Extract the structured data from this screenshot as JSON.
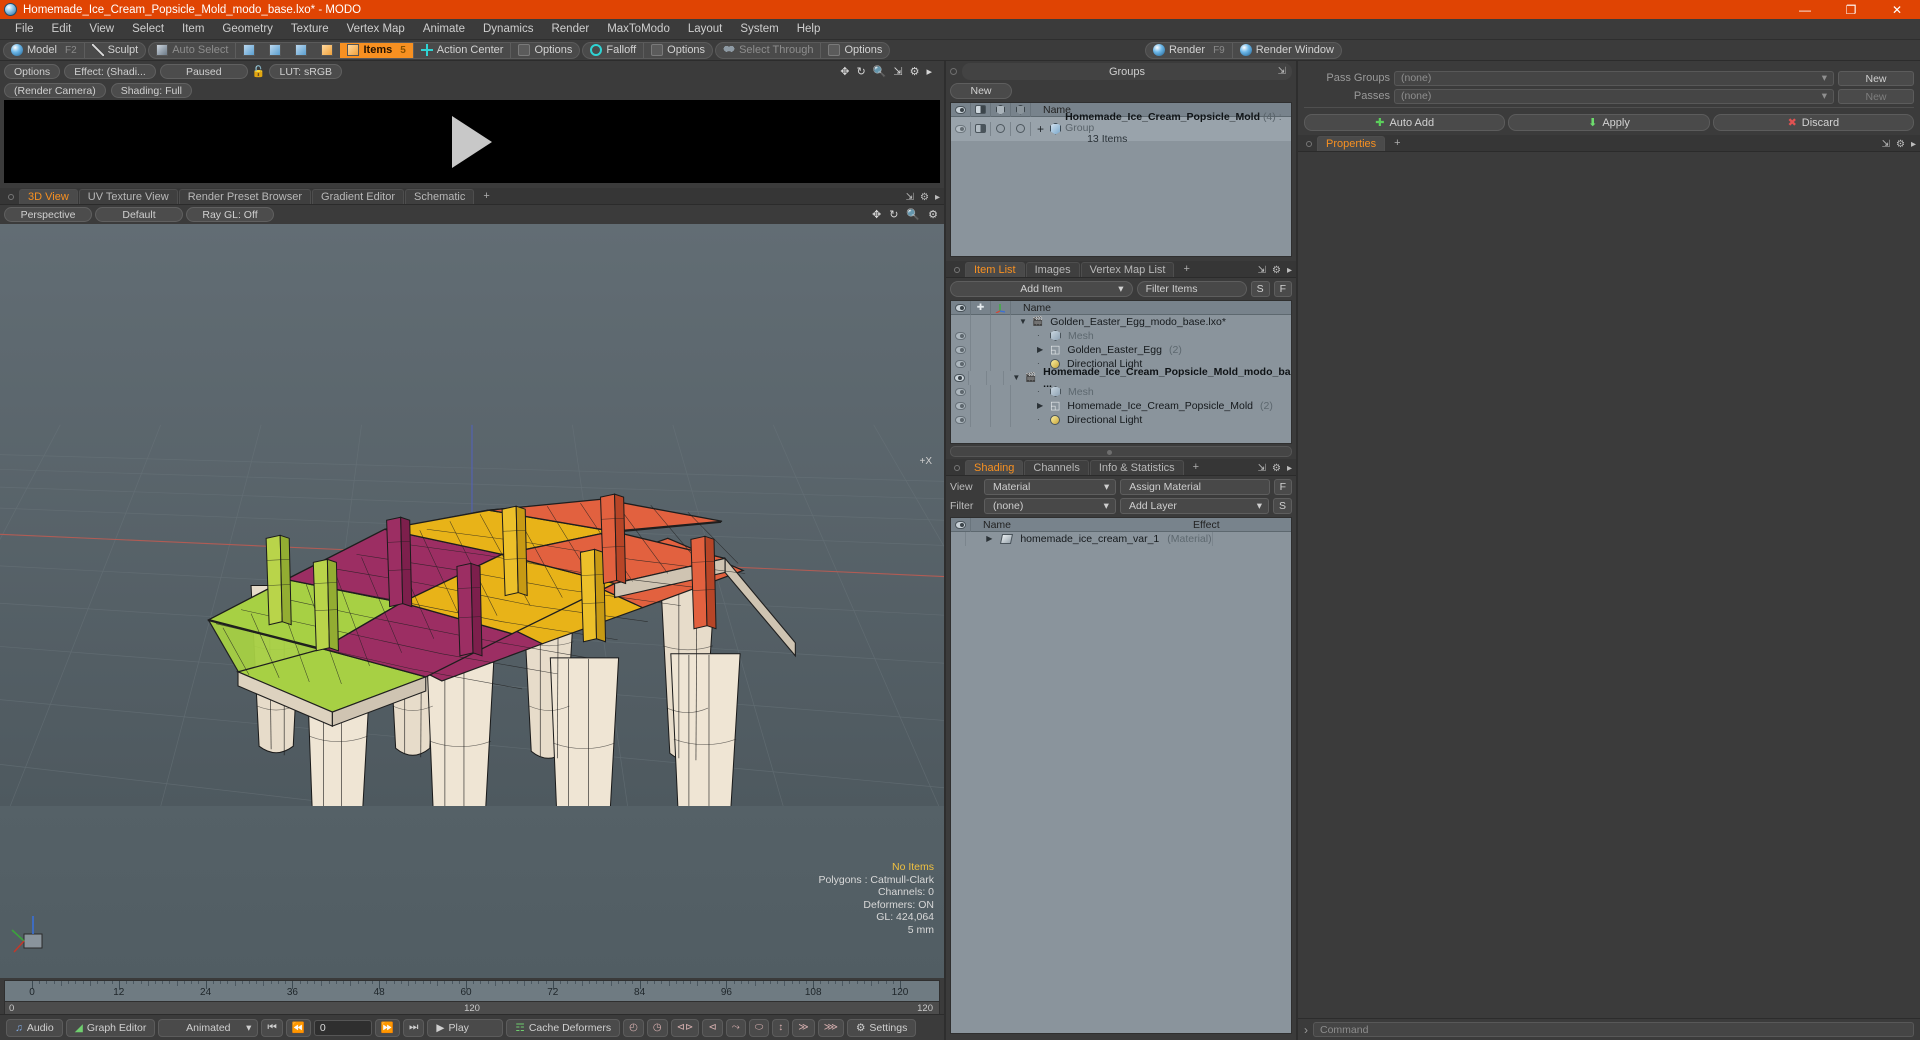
{
  "window": {
    "title": "Homemade_Ice_Cream_Popsicle_Mold_modo_base.lxo* - MODO",
    "app_icon": "modo-sphere-icon",
    "minimize": "—",
    "maximize": "❐",
    "close": "✕",
    "accent": "#e04403"
  },
  "menubar": {
    "items": [
      "File",
      "Edit",
      "View",
      "Select",
      "Item",
      "Geometry",
      "Texture",
      "Vertex Map",
      "Animate",
      "Dynamics",
      "Render",
      "MaxToModo",
      "Layout",
      "System",
      "Help"
    ]
  },
  "modebar": {
    "model": "Model",
    "model_key": "F2",
    "sculpt": "Sculpt",
    "auto_select": "Auto Select",
    "items": "Items",
    "items_key": "5",
    "action_center": "Action Center",
    "options1": "Options",
    "falloff": "Falloff",
    "options2": "Options",
    "select_through": "Select Through",
    "options3": "Options",
    "render": "Render",
    "render_key": "F9",
    "render_window": "Render Window"
  },
  "preview": {
    "options": "Options",
    "effect": "Effect: (Shadi...",
    "paused": "Paused",
    "lock_icon": "unlock-icon",
    "lut": "LUT: sRGB",
    "camera": "(Render Camera)",
    "shading": "Shading: Full",
    "tools": [
      "move-icon",
      "rotate-icon",
      "zoom-icon",
      "fit-icon",
      "gear-icon",
      "chevron-right-icon"
    ]
  },
  "viewport_tabs": {
    "tabs": [
      "3D View",
      "UV Texture View",
      "Render Preset Browser",
      "Gradient Editor",
      "Schematic"
    ],
    "selected": "3D View",
    "add": "+"
  },
  "viewport": {
    "perspective": "Perspective",
    "shading_preset": "Default",
    "raygl": "Ray GL: Off",
    "tools": [
      "move-icon",
      "rotate-icon",
      "zoom-icon",
      "gear-icon"
    ],
    "axis_label": "+X",
    "stats": {
      "selection": "No Items",
      "polygons": "Polygons : Catmull-Clark",
      "channels": "Channels: 0",
      "deformers": "Deformers: ON",
      "gl": "GL: 424,064",
      "scale": "5 mm"
    }
  },
  "timeline": {
    "ticks": [
      0,
      12,
      24,
      36,
      48,
      60,
      72,
      84,
      96,
      108,
      120
    ],
    "range_start": "0",
    "range_mid": "120",
    "range_end": "120",
    "current_frame": "0"
  },
  "bottombar": {
    "audio": "Audio",
    "graph_editor": "Graph Editor",
    "animated": "Animated",
    "frame_value": "0",
    "play": "Play",
    "cache_deformers": "Cache Deformers",
    "settings": "Settings",
    "nav_icons": [
      "jump-start-icon",
      "step-back-icon",
      "step-forward-icon",
      "jump-end-icon"
    ],
    "key_icons": [
      "key-clock-icon",
      "key-clock-alt-icon",
      "key-prev-icon",
      "key-next-icon",
      "curve-key-icon",
      "ellipse-key-icon",
      "bracket-key-icon",
      "next-key-icon",
      "last-key-icon"
    ]
  },
  "groups_panel": {
    "title": "Groups",
    "new_group": "New Group",
    "columns": [
      "eye-icon",
      "shade-icon",
      "wire-icon",
      "solid-icon",
      "Name"
    ],
    "rows": [
      {
        "name": "Homemade_Ice_Cream_Popsicle_Mold",
        "count": "(4)",
        "type": ": Group",
        "sub": "13 Items",
        "expander": "+"
      }
    ]
  },
  "item_list": {
    "tabs": [
      "Item List",
      "Images",
      "Vertex Map List"
    ],
    "selected_tab": "Item List",
    "add": "+",
    "add_item": "Add Item",
    "filter_placeholder": "Filter Items",
    "btn_s": "S",
    "btn_f": "F",
    "columns": [
      "eye-icon",
      "lock-icon",
      "axis-icon",
      "Name"
    ],
    "rows": [
      {
        "name": "Golden_Easter_Egg_modo_base.lxo*",
        "icon": "scene-icon",
        "indent": 0,
        "bold": false,
        "expander": "down",
        "eye": false
      },
      {
        "name": "Mesh",
        "icon": "mesh-icon",
        "indent": 1,
        "muted": true,
        "expander": "dot",
        "eye": true
      },
      {
        "name": "Golden_Easter_Egg",
        "count": "(2)",
        "icon": "group-folder-icon",
        "indent": 1,
        "expander": "right",
        "eye": true
      },
      {
        "name": "Directional Light",
        "icon": "light-icon",
        "indent": 1,
        "expander": "dot",
        "eye": true
      },
      {
        "name": "Homemade_Ice_Cream_Popsicle_Mold_modo_ba ...",
        "icon": "scene-icon",
        "indent": 0,
        "bold": true,
        "expander": "down",
        "eye": true
      },
      {
        "name": "Mesh",
        "icon": "mesh-icon",
        "indent": 1,
        "muted": true,
        "expander": "dot",
        "eye": true
      },
      {
        "name": "Homemade_Ice_Cream_Popsicle_Mold",
        "count": "(2)",
        "icon": "group-folder-icon",
        "indent": 1,
        "expander": "right",
        "eye": true
      },
      {
        "name": "Directional Light",
        "icon": "light-icon",
        "indent": 1,
        "expander": "dot",
        "eye": true
      }
    ]
  },
  "shading_panel": {
    "tabs": [
      "Shading",
      "Channels",
      "Info & Statistics"
    ],
    "selected_tab": "Shading",
    "add": "+",
    "view_label": "View",
    "view_value": "Material",
    "assign_material": "Assign Material",
    "filter_label": "Filter",
    "filter_value": "(none)",
    "add_layer": "Add Layer",
    "btn_f": "F",
    "btn_s": "S",
    "columns": [
      "eye-icon",
      "Name",
      "Effect"
    ],
    "rows": [
      {
        "name": "homemade_ice_cream_var_1",
        "type": "(Material)",
        "effect": "",
        "expander": "right",
        "icon": "material-icon"
      }
    ]
  },
  "right_panel": {
    "pass_groups_label": "Pass Groups",
    "pass_groups_value": "(none)",
    "pass_groups_new": "New",
    "passes_label": "Passes",
    "passes_value": "(none)",
    "passes_new": "New",
    "auto_add": "Auto Add",
    "apply": "Apply",
    "discard": "Discard",
    "properties_tab": "Properties",
    "add": "+"
  },
  "command_bar": {
    "placeholder": "Command",
    "chevron": "›"
  }
}
